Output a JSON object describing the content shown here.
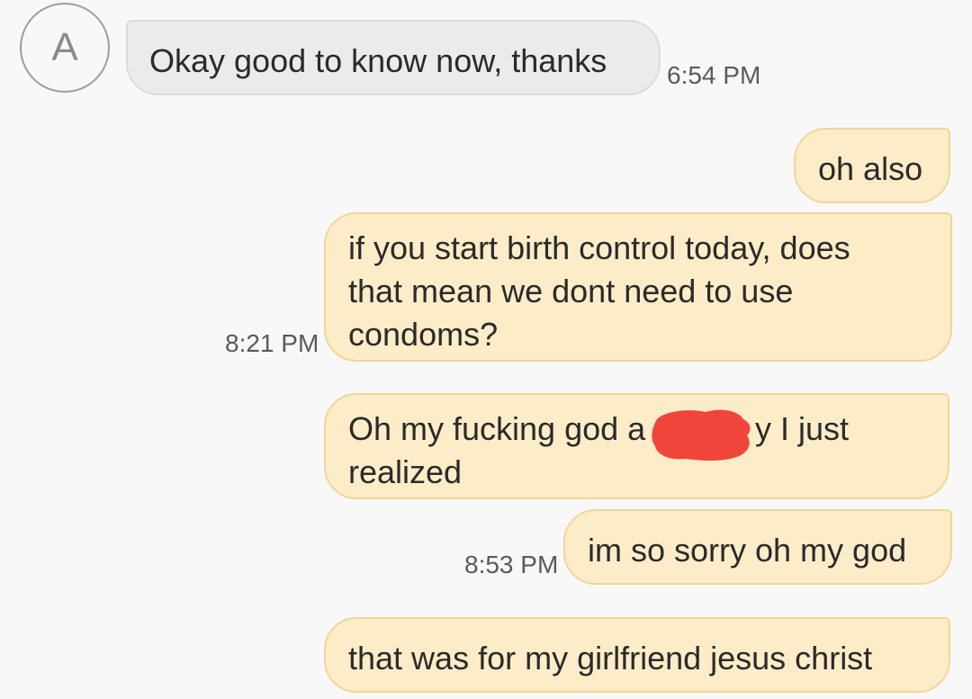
{
  "contact": {
    "avatar_initial": "A"
  },
  "messages": [
    {
      "direction": "incoming",
      "text": "Okay good to know now, thanks",
      "time": "6:54 PM"
    },
    {
      "direction": "outgoing",
      "text": "oh also",
      "time": ""
    },
    {
      "direction": "outgoing",
      "lines": [
        "if you start birth control today, does",
        "that mean we dont need to use",
        "condoms?"
      ],
      "time": "8:21 PM"
    },
    {
      "direction": "outgoing",
      "lines": [
        "Oh my fucking god a",
        "y I just",
        "realized"
      ],
      "time": ""
    },
    {
      "direction": "outgoing",
      "text": "im so sorry oh my god",
      "time": "8:53 PM"
    },
    {
      "direction": "outgoing",
      "text": "that was for my girlfriend jesus christ",
      "time": ""
    }
  ],
  "colors": {
    "background": "#f8f8f8",
    "incoming_bubble": "#ebebeb",
    "outgoing_bubble": "#fdecc8",
    "outgoing_border": "#f0d69a",
    "redaction": "#f0453a"
  }
}
